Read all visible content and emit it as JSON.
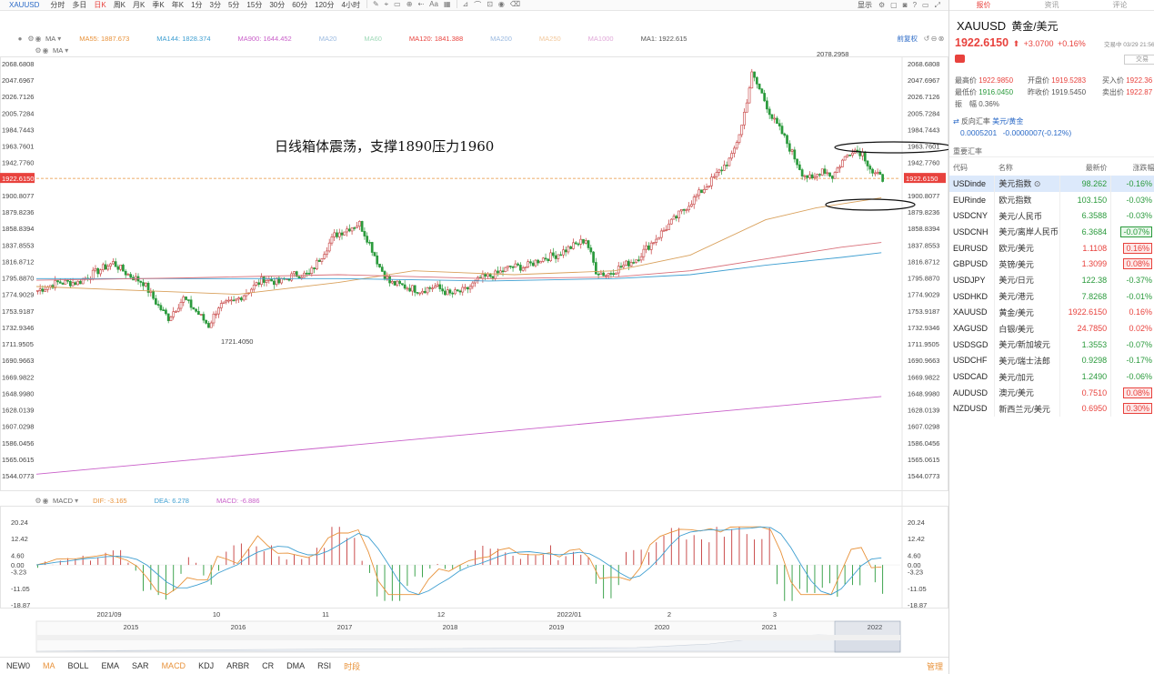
{
  "toolbar": {
    "symbol": "XAUUSD",
    "timeframes": [
      "分时",
      "多日",
      "日K",
      "周K",
      "月K",
      "季K",
      "年K",
      "1分",
      "3分",
      "5分",
      "15分",
      "30分",
      "60分",
      "120分",
      "4小时"
    ],
    "active_timeframe": "日K",
    "display_label": "显示"
  },
  "ma_main": {
    "label": "MA",
    "items": [
      {
        "text": "MA55: 1887.673",
        "color": "#e8923a"
      },
      {
        "text": "MA144: 1828.374",
        "color": "#3f9fd1"
      },
      {
        "text": "MA900: 1644.452",
        "color": "#c95fc9"
      },
      {
        "text": "MA20",
        "color": "#9ab9e0"
      },
      {
        "text": "MA60",
        "color": "#9fd9b8"
      },
      {
        "text": "MA120: 1841.388",
        "color": "#e8423d"
      },
      {
        "text": "MA200",
        "color": "#9ab9e0"
      },
      {
        "text": "MA250",
        "color": "#f2c79a"
      },
      {
        "text": "MA1000",
        "color": "#e0a8d8"
      },
      {
        "text": "MA1: 1922.615",
        "color": "#555555"
      }
    ],
    "adjust_label": "前复权"
  },
  "ma_second": {
    "label": "MA"
  },
  "price_axis": {
    "ticks": [
      "2068.6808",
      "2047.6967",
      "2026.7126",
      "2005.7284",
      "1984.7443",
      "1963.7601",
      "1942.7760",
      "1921.7919",
      "1900.8077",
      "1879.8236",
      "1858.8394",
      "1837.8553",
      "1816.8712",
      "1795.8870",
      "1774.9029",
      "1753.9187",
      "1732.9346",
      "1711.9505",
      "1690.9663",
      "1669.9822",
      "1648.9980",
      "1628.0139",
      "1607.0298",
      "1586.0456",
      "1565.0615",
      "1544.0773"
    ],
    "current": "1922.6150",
    "high_label": "2078.2958",
    "low_label": "1721.4050"
  },
  "annotation": "日线箱体震荡，支撑1890压力1960",
  "macd": {
    "label": "MACD",
    "dif": "DIF: -3.165",
    "dea": "DEA: 6.278",
    "macd": "MACD: -6.886",
    "ticks": [
      "20.24",
      "12.42",
      "4.60",
      "0.00",
      "-3.23",
      "-11.05",
      "-18.87"
    ]
  },
  "time_axis": {
    "upper": [
      "2021/09",
      "10",
      "11",
      "12",
      "2022/01",
      "2",
      "3"
    ],
    "lower": [
      "2015",
      "2016",
      "2017",
      "2018",
      "2019",
      "2020",
      "2021",
      "2022"
    ]
  },
  "indicator_tabs": [
    "NEW0",
    "MA",
    "BOLL",
    "EMA",
    "SAR",
    "MACD",
    "KDJ",
    "ARBR",
    "CR",
    "DMA",
    "RSI",
    "时段"
  ],
  "manage_label": "管理",
  "panel": {
    "tabs": [
      "报价",
      "资讯",
      "评论"
    ],
    "symbol": "XAUUSD",
    "name": "黄金/美元",
    "price": "1922.6150",
    "change": "+3.0700",
    "change_pct": "+0.16%",
    "time": "交易中 03/29 21:56(",
    "trade_btn": "交易",
    "stats": {
      "high_label": "最高价",
      "high": "1922.9850",
      "open_label": "开盘价",
      "open": "1919.5283",
      "buy_label": "买入价",
      "buy": "1922.36",
      "low_label": "最低价",
      "low": "1916.0450",
      "prev_label": "昨收价",
      "prev": "1919.5450",
      "sell_label": "卖出价",
      "sell": "1922.87",
      "amp_label": "振　幅",
      "amp": "0.36%"
    },
    "reverse": {
      "label": "反向汇率",
      "pair": "美元/黄金",
      "value": "0.0005201",
      "change": "-0.0000007(-0.12%)"
    },
    "section_title": "重要汇率",
    "table_headers": [
      "代码",
      "名称",
      "最新价",
      "涨跌幅"
    ],
    "rows": [
      {
        "code": "USDinde",
        "name": "美元指数",
        "last": "98.262",
        "pct": "-0.16%",
        "dir": "down"
      },
      {
        "code": "EURinde",
        "name": "欧元指数",
        "last": "103.150",
        "pct": "-0.03%",
        "dir": "down"
      },
      {
        "code": "USDCNY",
        "name": "美元/人民币",
        "last": "6.3588",
        "pct": "-0.03%",
        "dir": "down"
      },
      {
        "code": "USDCNH",
        "name": "美元/离岸人民币",
        "last": "6.3684",
        "pct": "-0.07%",
        "dir": "down"
      },
      {
        "code": "EURUSD",
        "name": "欧元/美元",
        "last": "1.1108",
        "pct": "0.16%",
        "dir": "up"
      },
      {
        "code": "GBPUSD",
        "name": "英镑/美元",
        "last": "1.3099",
        "pct": "0.08%",
        "dir": "up"
      },
      {
        "code": "USDJPY",
        "name": "美元/日元",
        "last": "122.38",
        "pct": "-0.37%",
        "dir": "down"
      },
      {
        "code": "USDHKD",
        "name": "美元/港元",
        "last": "7.8268",
        "pct": "-0.01%",
        "dir": "down"
      },
      {
        "code": "XAUUSD",
        "name": "黄金/美元",
        "last": "1922.6150",
        "pct": "0.16%",
        "dir": "up"
      },
      {
        "code": "XAGUSD",
        "name": "白银/美元",
        "last": "24.7850",
        "pct": "0.02%",
        "dir": "up"
      },
      {
        "code": "USDSGD",
        "name": "美元/新加坡元",
        "last": "1.3553",
        "pct": "-0.07%",
        "dir": "down"
      },
      {
        "code": "USDCHF",
        "name": "美元/瑞士法郎",
        "last": "0.9298",
        "pct": "-0.17%",
        "dir": "down"
      },
      {
        "code": "USDCAD",
        "name": "美元/加元",
        "last": "1.2490",
        "pct": "-0.06%",
        "dir": "down"
      },
      {
        "code": "AUDUSD",
        "name": "澳元/美元",
        "last": "0.7510",
        "pct": "0.08%",
        "dir": "up"
      },
      {
        "code": "NZDUSD",
        "name": "新西兰元/美元",
        "last": "0.6950",
        "pct": "0.30%",
        "dir": "up"
      }
    ]
  }
}
